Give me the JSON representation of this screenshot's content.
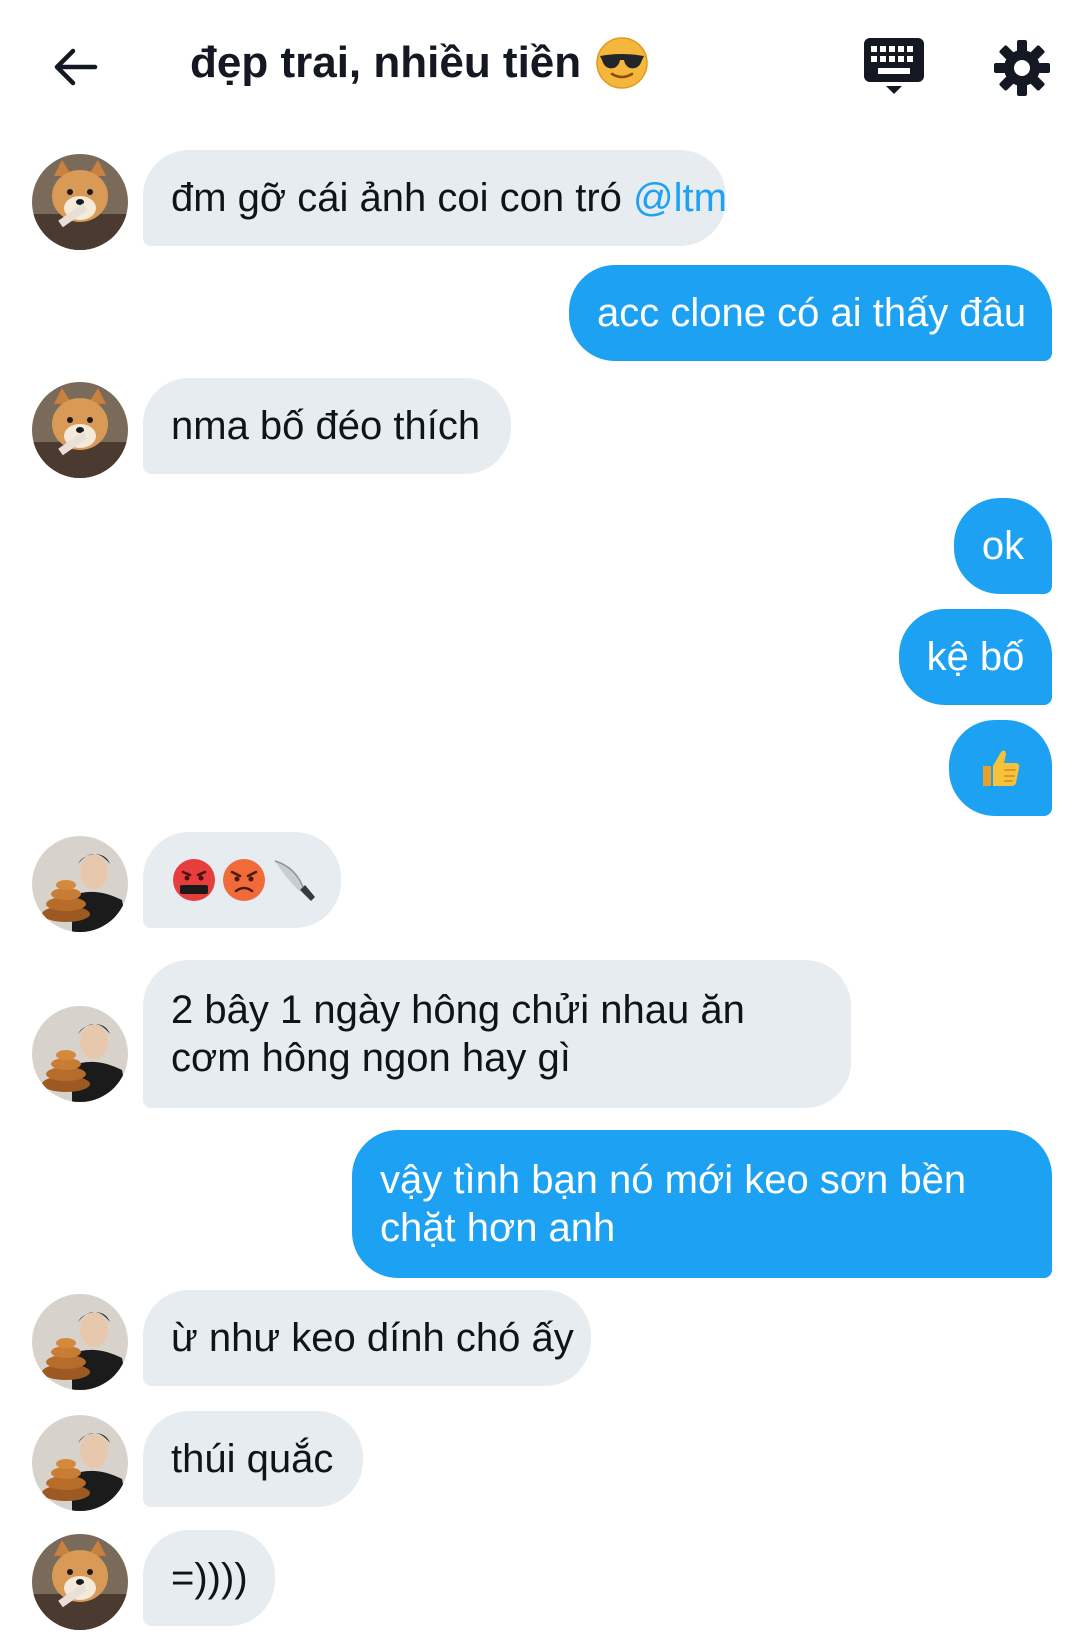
{
  "header": {
    "title": "đẹp trai, nhiều tiền",
    "back_icon": "arrow-left-icon",
    "keyboard_icon": "keyboard-icon",
    "settings_icon": "gear-icon",
    "title_emoji": "sunglasses-face-emoji"
  },
  "colors": {
    "incoming_bubble": "#e6ecf0",
    "outgoing_bubble": "#1da1f2",
    "mention": "#1da1f2",
    "text": "#0f1419"
  },
  "messages": [
    {
      "dir": "in",
      "avatar": "shiba-dog",
      "text": "đm gỡ cái ảnh coi con tró ",
      "mention": "@ltm"
    },
    {
      "dir": "out",
      "text": "acc clone có ai thấy đâu"
    },
    {
      "dir": "in",
      "avatar": "shiba-dog",
      "text": "nma bố đéo thích"
    },
    {
      "dir": "out",
      "text": "ok"
    },
    {
      "dir": "out",
      "text": "kệ bố"
    },
    {
      "dir": "out",
      "emoji": "thumbs-up"
    },
    {
      "dir": "in",
      "avatar": "person-with-bread",
      "emoji": [
        "cursing-face",
        "angry-face",
        "kitchen-knife"
      ]
    },
    {
      "dir": "in",
      "avatar": "person-with-bread",
      "lines": [
        "2 bây 1 ngày hông chửi nhau ăn",
        "cơm hông ngon hay gì"
      ]
    },
    {
      "dir": "out",
      "lines": [
        "vậy tình bạn nó mới keo sơn bền",
        "chặt hơn anh"
      ]
    },
    {
      "dir": "in",
      "avatar": "person-with-bread",
      "text": "ừ như keo dính chó ấy"
    },
    {
      "dir": "in",
      "avatar": "person-with-bread",
      "text": "thúi quắc"
    },
    {
      "dir": "in",
      "avatar": "shiba-dog",
      "text": "=))))"
    }
  ]
}
